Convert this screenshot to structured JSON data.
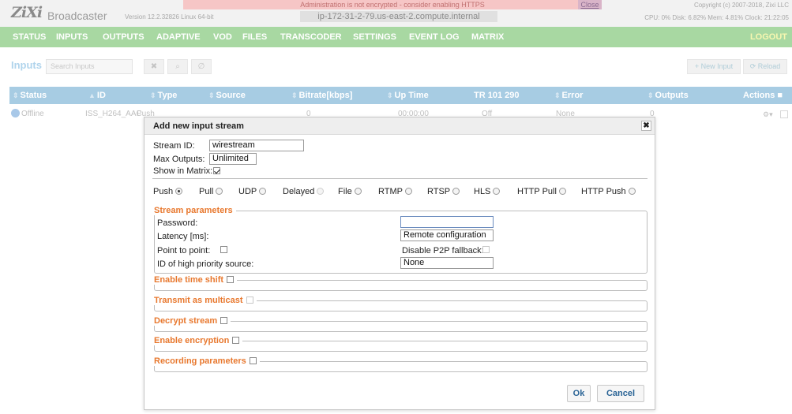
{
  "header": {
    "logo": "ZiXi",
    "brand": "Broadcaster",
    "version": "Version 12.2.32826 Linux 64-bit",
    "warning": "Administration is not encrypted - consider enabling HTTPS",
    "warning_close": "Close",
    "hostname": "ip-172-31-2-79.us-east-2.compute.internal",
    "copyright": "Copyright (c) 2007-2018, Zixi LLC",
    "stats": "CPU: 0%  Disk: 6.82%  Mem: 4.81%  Clock: 21:22:05"
  },
  "nav": {
    "items": [
      "STATUS",
      "INPUTS",
      "OUTPUTS",
      "ADAPTIVE",
      "VOD",
      "FILES",
      "TRANSCODER",
      "SETTINGS",
      "EVENT LOG",
      "MATRIX"
    ],
    "logout": "LOGOUT"
  },
  "toolbar": {
    "title": "Inputs",
    "search_placeholder": "Search Inputs",
    "new_input": "+ New Input",
    "reload": "⟳ Reload"
  },
  "table": {
    "columns": [
      "Status",
      "ID",
      "Type",
      "Source",
      "Bitrate[kbps]",
      "Up Time",
      "TR 101 290",
      "Error",
      "Outputs",
      "Actions"
    ],
    "rows": [
      {
        "status": "Offline",
        "id": "ISS_H264_AAC",
        "type": "Push",
        "source": "",
        "bitrate": "0",
        "uptime": "00:00:00",
        "tr": "Off",
        "error": "None",
        "outputs": "0"
      }
    ]
  },
  "modal": {
    "title": "Add new input stream",
    "close": "✖",
    "stream_id_label": "Stream ID:",
    "stream_id_value": "wirestream",
    "max_outputs_label": "Max Outputs:",
    "max_outputs_value": "Unlimited",
    "show_matrix_label": "Show in Matrix:",
    "show_matrix_checked": true,
    "protocols": [
      {
        "label": "Push",
        "selected": true,
        "enabled": true
      },
      {
        "label": "Pull",
        "selected": false,
        "enabled": true
      },
      {
        "label": "UDP",
        "selected": false,
        "enabled": true
      },
      {
        "label": "Delayed",
        "selected": false,
        "enabled": false
      },
      {
        "label": "File",
        "selected": false,
        "enabled": true
      },
      {
        "label": "RTMP",
        "selected": false,
        "enabled": true
      },
      {
        "label": "RTSP",
        "selected": false,
        "enabled": true
      },
      {
        "label": "HLS",
        "selected": false,
        "enabled": true
      },
      {
        "label": "HTTP Pull",
        "selected": false,
        "enabled": true
      },
      {
        "label": "HTTP Push",
        "selected": false,
        "enabled": true
      }
    ],
    "stream_params": {
      "legend": "Stream parameters",
      "password_label": "Password:",
      "password_value": "",
      "latency_label": "Latency [ms]:",
      "latency_value": "Remote configuration",
      "p2p_label": "Point to point:",
      "disable_p2p_label": "Disable P2P fallback:",
      "priority_label": "ID of high priority source:",
      "priority_value": "None"
    },
    "sections": [
      "Enable time shift",
      "Transmit as multicast",
      "Decrypt stream",
      "Enable encryption",
      "Recording parameters"
    ],
    "ok": "Ok",
    "cancel": "Cancel"
  }
}
